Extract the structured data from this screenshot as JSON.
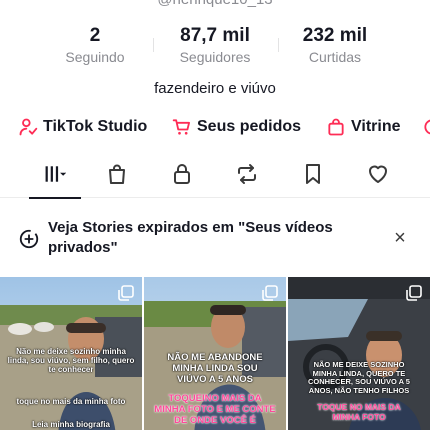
{
  "profile": {
    "username": "@henrique10_13",
    "bio": "fazendeiro e viúvo"
  },
  "stats": [
    {
      "value": "2",
      "label": "Seguindo"
    },
    {
      "value": "87,7 mil",
      "label": "Seguidores"
    },
    {
      "value": "232 mil",
      "label": "Curtidas"
    }
  ],
  "links": [
    {
      "label": "TikTok Studio",
      "icon": "person-icon"
    },
    {
      "label": "Seus pedidos",
      "icon": "cart-icon"
    },
    {
      "label": "Vitrine",
      "icon": "bag-icon"
    }
  ],
  "tabs": [
    {
      "name": "videos",
      "icon": "grid-icon",
      "active": true
    },
    {
      "name": "shop",
      "icon": "shopping-bag-icon"
    },
    {
      "name": "private",
      "icon": "lock-icon"
    },
    {
      "name": "reposts",
      "icon": "repost-icon"
    },
    {
      "name": "favorites",
      "icon": "bookmark-icon"
    },
    {
      "name": "liked",
      "icon": "heart-icon"
    }
  ],
  "banner": {
    "text": "Veja Stories expirados em \"Seus vídeos privados\"",
    "close": "×"
  },
  "videos": [
    {
      "caption_1": "Não me deixe sozinho minha linda, sou viúvo, sem filho, quero te conhecer",
      "caption_2": "toque no mais da minha foto",
      "caption_3": "Leia minha biografia"
    },
    {
      "caption_1": "NÃO ME ABANDONE MINHA LINDA SOU VIÚVO A 5 ANOS",
      "caption_2": "TOQUEINO MAIS DA MINHA FOTO E ME CONTE DE ONDE VOCÊ É"
    },
    {
      "caption_1": "NÃO ME DEIXE SOZINHO MINHA LINDA, QUERO TE CONHECER, SOU VIÚVO A 5 ANOS, NÃO TENHO FILHOS",
      "caption_2": "TOQUE NO MAIS DA MINHA FOTO"
    }
  ],
  "colors": {
    "accent_pink": "#fe2c55",
    "text": "#161823",
    "muted": "#8a8b91"
  }
}
